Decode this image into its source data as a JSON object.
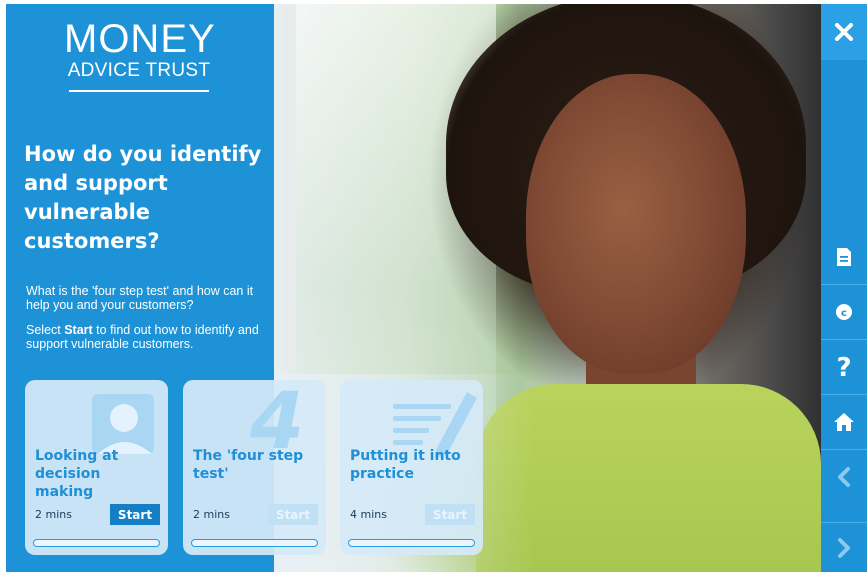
{
  "logo": {
    "line1": "MONEY",
    "line2": "ADVICE TRUST"
  },
  "headline": "How do you identify and support vulnerable customers?",
  "intro": {
    "p1": "What is the 'four step test' and how can it help you and your customers?",
    "p2_before": "Select ",
    "p2_bold": "Start",
    "p2_after": " to find out how to identify and support vulnerable customers."
  },
  "cards": [
    {
      "title": "Looking at decision making",
      "duration": "2 mins",
      "start_label": "Start",
      "state": "active",
      "progress": 0
    },
    {
      "title": "The 'four step test'",
      "duration": "2 mins",
      "start_label": "Start",
      "state": "disabled",
      "progress": 0
    },
    {
      "title": "Putting it into practice",
      "duration": "4 mins",
      "start_label": "Start",
      "state": "disabled",
      "progress": 0
    }
  ],
  "nav": {
    "close_icon": "close-icon",
    "items": [
      "document-icon",
      "copyright-icon",
      "help-icon",
      "home-icon",
      "chevron-left-icon",
      "chevron-right-icon"
    ]
  },
  "colors": {
    "brand_blue": "#1d92d7",
    "button_blue": "#147fc4",
    "card_bg": "#d5eaf8",
    "title_blue": "#1f8fd6"
  }
}
